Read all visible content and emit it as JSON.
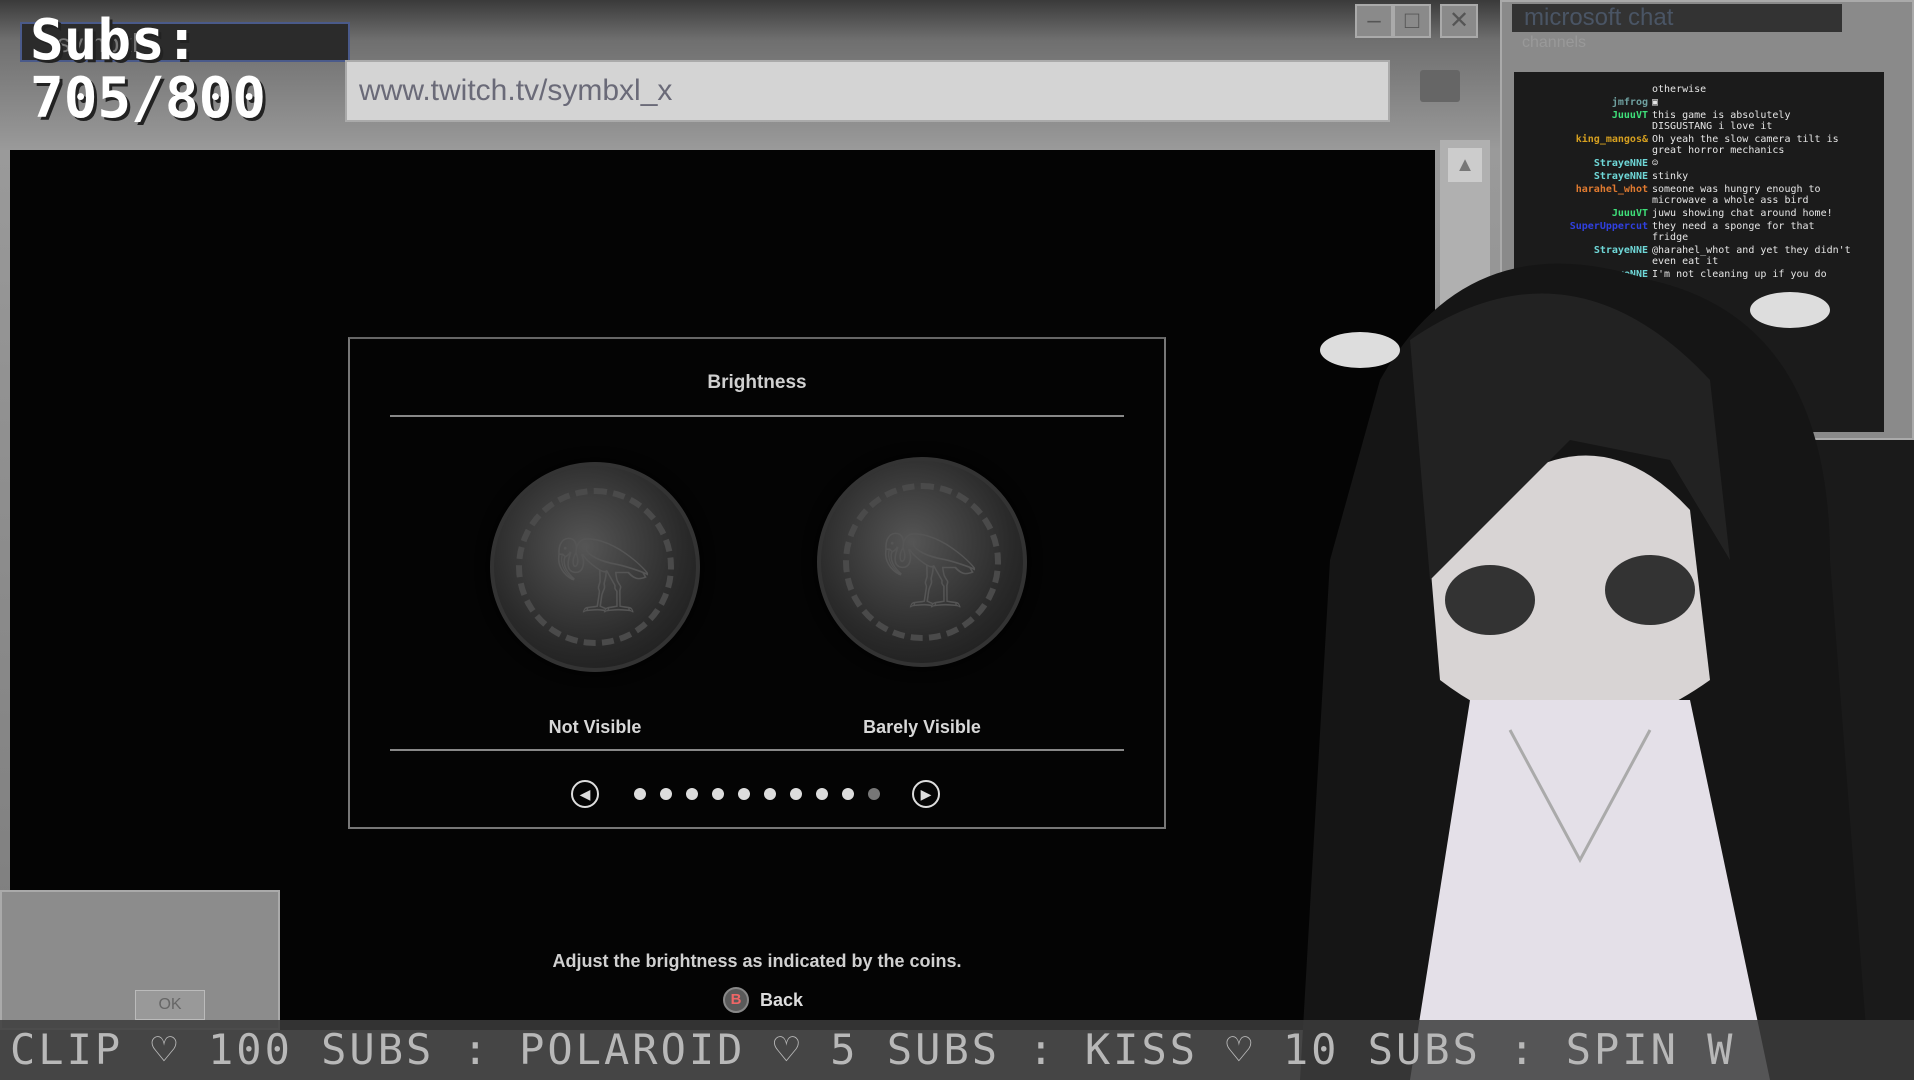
{
  "overlay": {
    "subs_label": "Subs:",
    "subs_count": "705/800"
  },
  "browser": {
    "tab_title": "symbxl",
    "url": "www.twitch.tv/symbxl_x",
    "minimize": "–",
    "maximize": "□",
    "close": "✕"
  },
  "dialog": {
    "title": "Brightness",
    "left_label": "Not Visible",
    "right_label": "Barely Visible",
    "pager_total": 10,
    "pager_active": 9,
    "instruction": "Adjust the brightness as indicated by the coins.",
    "back_button_key": "B",
    "back_label": "Back"
  },
  "chat": {
    "title": "microsoft chat",
    "subtitle": "channels",
    "messages": [
      {
        "user": "",
        "text": "otherwise",
        "color": "#cccccc"
      },
      {
        "user": "jmfrog",
        "text": "▣",
        "color": "#6fa0a0"
      },
      {
        "user": "JuuuVT",
        "text": "this game is absolutely DISGUSTANG i love it",
        "color": "#3fe07a"
      },
      {
        "user": "king_mangos&",
        "text": "Oh yeah the slow camera tilt is great horror mechanics",
        "color": "#d6a020"
      },
      {
        "user": "StrayeNNE",
        "text": "☺",
        "color": "#6fd8d8"
      },
      {
        "user": "StrayeNNE",
        "text": "stinky",
        "color": "#6fd8d8"
      },
      {
        "user": "harahel_whot",
        "text": "someone was hungry enough to microwave a whole ass bird",
        "color": "#e07a30"
      },
      {
        "user": "JuuuVT",
        "text": "juwu showing chat around home!",
        "color": "#3fe07a"
      },
      {
        "user": "SuperUppercut",
        "text": "they need a sponge for that fridge",
        "color": "#3040e0"
      },
      {
        "user": "StrayeNNE",
        "text": "@harahel_whot and yet they didn't even eat it",
        "color": "#6fd8d8"
      },
      {
        "user": "StrayeNNE",
        "text": "I'm not cleaning up if you do",
        "color": "#6fd8d8"
      }
    ]
  },
  "old_window": {
    "ok_label": "OK"
  },
  "ticker": {
    "text": "CLIP ♡ 100 SUBS : POLAROID ♡ 5 SUBS : KISS ♡ 10 SUBS : SPIN W"
  }
}
